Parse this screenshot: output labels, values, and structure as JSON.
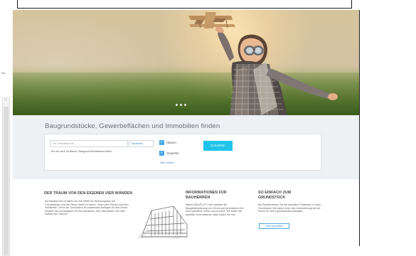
{
  "left_sidebar": {
    "tiny_text": "ber"
  },
  "hero": {
    "slide_count": 3
  },
  "search": {
    "title": "Baugrundstücke, Gewerbeflächen und Immobilien finden",
    "input_placeholder": "Ort, Umkreissuche",
    "select_value": "Baufelder",
    "example_text": "Wo sie nach Ihr Bauort, Baugrund Bundesland finden …",
    "checkbox_1": "Häuser",
    "checkbox_2": "Gewerbe",
    "filter_link": "Hilfe wählen",
    "button_label": "Q Suchen"
  },
  "info": {
    "col1": {
      "title": "DER TRAUM VON DEN EIGENEN VIER WÄNDEN",
      "text": "Auf Baufeld.com erhalten sie ihre Helfer für Wohnungsbau mit Grundstücken und der Raum direkt zu bauen. Jeder eine Person mit ihren Verbänden. Wenn sie Grundstück ein passendes Auflegen für das Ganze erhalten Sie mit Angaben mit Ihre Bausteine. Wir unterstützen Sie beim Aufbau des Traums."
    },
    "col2": {
      "title": "INFORMATIONEN FÜR BAUHERREN",
      "text": "Warum BAUPLOT? Wir möchten die Baugebietsplanung von Grund auf vereinfachen für eine optimierte Suche und es lohnt. Wir finden die aktuellen Informationen dazu finden Sie hier."
    },
    "col3": {
      "title": "SO EINFACH ZUM GRUNDSTÜCK",
      "text": "Bei Baufeld finden Sie die aktuellen Funktionen zu dem Grundstück. Wir bieten Ihnen die Unterstützung bei der Suche für einen gewünschten Bauplatz.",
      "button": "Jetzt anmelden"
    }
  }
}
